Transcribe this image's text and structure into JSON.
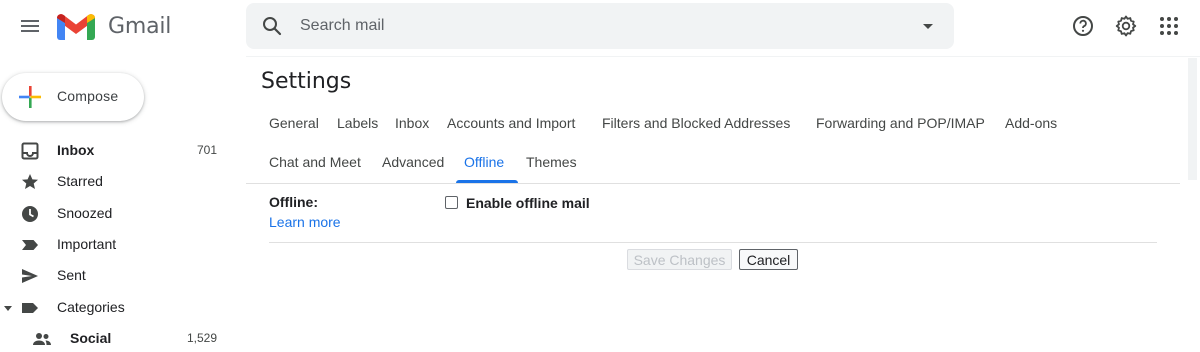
{
  "app": {
    "brand": "Gmail",
    "search_placeholder": "Search mail"
  },
  "header_icons": {
    "menu": "menu-icon",
    "help": "help-icon",
    "settings": "gear-icon",
    "apps": "apps-grid-icon"
  },
  "sidebar": {
    "compose_label": "Compose",
    "items": [
      {
        "label": "Inbox",
        "count": "701",
        "icon": "inbox-icon",
        "bold": true
      },
      {
        "label": "Starred",
        "count": "",
        "icon": "star-icon",
        "bold": false
      },
      {
        "label": "Snoozed",
        "count": "",
        "icon": "clock-icon",
        "bold": false
      },
      {
        "label": "Important",
        "count": "",
        "icon": "important-icon",
        "bold": false
      },
      {
        "label": "Sent",
        "count": "",
        "icon": "send-icon",
        "bold": false
      },
      {
        "label": "Categories",
        "count": "",
        "icon": "label-icon",
        "bold": false
      },
      {
        "label": "Social",
        "count": "1,529",
        "icon": "people-icon",
        "bold": true
      }
    ]
  },
  "settings": {
    "title": "Settings",
    "tabs_row1": [
      "General",
      "Labels",
      "Inbox",
      "Accounts and Import",
      "Filters and Blocked Addresses",
      "Forwarding and POP/IMAP",
      "Add-ons"
    ],
    "tabs_row2": [
      "Chat and Meet",
      "Advanced",
      "Offline",
      "Themes"
    ],
    "active_tab": "Offline",
    "offline_label": "Offline:",
    "learn_more": "Learn more",
    "enable_offline_label": "Enable offline mail",
    "enable_offline_checked": false,
    "save_label": "Save Changes",
    "cancel_label": "Cancel"
  },
  "colors": {
    "accent": "#1a73e8",
    "search_bg": "#f1f3f4",
    "text": "#202124"
  }
}
